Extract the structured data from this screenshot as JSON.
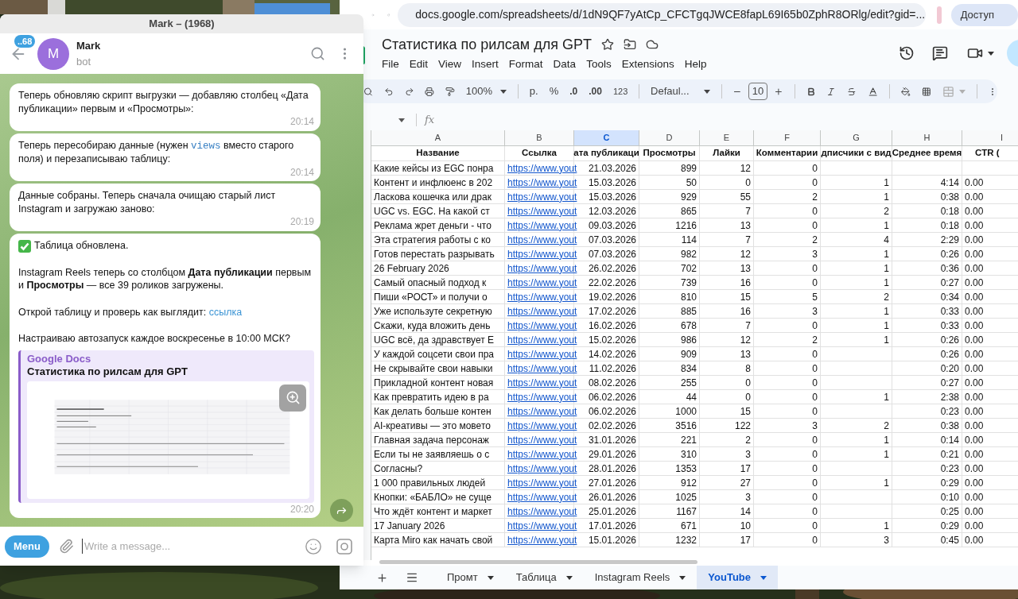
{
  "telegram": {
    "window_title": "Mark – (1968)",
    "unread_badge": "..68",
    "avatar_letter": "M",
    "chat_name": "Mark",
    "chat_status": "bot",
    "messages": [
      {
        "time": "20:14",
        "paragraphs": [
          {
            "parts": [
              {
                "kind": "text",
                "text": "Теперь обновляю скрипт выгрузки — добавляю столбец «Дата публикации» первым и «Просмотры»:"
              }
            ]
          }
        ]
      },
      {
        "time": "20:14",
        "paragraphs": [
          {
            "parts": [
              {
                "kind": "text",
                "text": "Теперь пересобираю данные (нужен "
              },
              {
                "kind": "code",
                "text": "views"
              },
              {
                "kind": "text",
                "text": " вместо старого поля) и перезаписываю таблицу:"
              }
            ]
          }
        ]
      },
      {
        "time": "20:19",
        "paragraphs": [
          {
            "parts": [
              {
                "kind": "text",
                "text": "Данные собраны. Теперь сначала очищаю старый лист Instagram и загружаю заново:"
              }
            ]
          }
        ]
      },
      {
        "time": "20:20",
        "paragraphs": [
          {
            "done": true,
            "parts": [
              {
                "kind": "text",
                "text": "Таблица обновлена."
              }
            ]
          },
          {
            "parts": [
              {
                "kind": "text",
                "text": "Instagram Reels теперь со столбцом **Дата публикации** первым и **Просмотры** — все 39 роликов загружены."
              }
            ]
          },
          {
            "parts": [
              {
                "kind": "text",
                "text": "Открой таблицу и проверь как выглядит: "
              },
              {
                "kind": "link",
                "text": "ссылка"
              }
            ]
          },
          {
            "parts": [
              {
                "kind": "text",
                "text": "Настраиваю автозапуск каждое воскресенье в 10:00 МСК?"
              }
            ]
          }
        ],
        "preview": {
          "site": "Google Docs",
          "title": "Статистика по рилсам для GPT"
        }
      }
    ],
    "menu_button": "Menu",
    "input": {
      "placeholder": "Write a message..."
    }
  },
  "browser": {
    "url": "docs.google.com/spreadsheets/d/1dN9QF7yAtCp_CFCTgqJWCE8fapL69I65b0ZphR8ORlg/edit?gid=...",
    "share_button": "Доступ"
  },
  "sheet": {
    "title": "Статистика по рилсам для GPT",
    "menu": [
      "File",
      "Edit",
      "View",
      "Insert",
      "Format",
      "Data",
      "Tools",
      "Extensions",
      "Help"
    ],
    "toolbar": {
      "zoom": "100%",
      "currency": "р.",
      "percent": "%",
      "decrease_decimal": ".0",
      "increase_decimal": ".00",
      "number_format": "123",
      "font": "Defaul...",
      "font_size": "10"
    },
    "formula_label": "fx",
    "columns": [
      {
        "letter": "A",
        "selected": false
      },
      {
        "letter": "B",
        "selected": false
      },
      {
        "letter": "C",
        "selected": true
      },
      {
        "letter": "D",
        "selected": false
      },
      {
        "letter": "E",
        "selected": false
      },
      {
        "letter": "F",
        "selected": false
      },
      {
        "letter": "G",
        "selected": false
      },
      {
        "letter": "H",
        "selected": false
      },
      {
        "letter": "I",
        "selected": false
      }
    ],
    "header_row": [
      "Название",
      "Ссылка",
      "ата публикаци",
      "Просмотры",
      "Лайки",
      "Комментарии",
      "дписчики с вид",
      "Среднее время",
      "CTR ("
    ],
    "rows": [
      {
        "title": "Какие кейсы из EGC понра",
        "link": "https://www.yout",
        "date": "21.03.2026",
        "views": "899",
        "likes": "12",
        "comments": "0"
      },
      {
        "title": "Контент и инфлюенс в 202",
        "link": "https://www.yout",
        "date": "15.03.2026",
        "views": "50",
        "likes": "0",
        "comments": "0",
        "subscribers": "1",
        "avg_time": "4:14",
        "ctr": "0.00"
      },
      {
        "title": "Ласкова кошечка или драк",
        "link": "https://www.yout",
        "date": "15.03.2026",
        "views": "929",
        "likes": "55",
        "comments": "2",
        "subscribers": "1",
        "avg_time": "0:38",
        "ctr": "0.00"
      },
      {
        "title": "UGC vs. EGC. На какой ст",
        "link": "https://www.yout",
        "date": "12.03.2026",
        "views": "865",
        "likes": "7",
        "comments": "0",
        "subscribers": "2",
        "avg_time": "0:18",
        "ctr": "0.00"
      },
      {
        "title": "Реклама жрет деньги - что",
        "link": "https://www.yout",
        "date": "09.03.2026",
        "views": "1216",
        "likes": "13",
        "comments": "0",
        "subscribers": "1",
        "avg_time": "0:18",
        "ctr": "0.00"
      },
      {
        "title": "Эта стратегия работы с ко",
        "link": "https://www.yout",
        "date": "07.03.2026",
        "views": "114",
        "likes": "7",
        "comments": "2",
        "subscribers": "4",
        "avg_time": "2:29",
        "ctr": "0.00"
      },
      {
        "title": "Готов перестать разрывать",
        "link": "https://www.yout",
        "date": "07.03.2026",
        "views": "982",
        "likes": "12",
        "comments": "3",
        "subscribers": "1",
        "avg_time": "0:26",
        "ctr": "0.00"
      },
      {
        "title": "26 February 2026",
        "link": "https://www.yout",
        "date": "26.02.2026",
        "views": "702",
        "likes": "13",
        "comments": "0",
        "subscribers": "1",
        "avg_time": "0:36",
        "ctr": "0.00"
      },
      {
        "title": "Самый опасный подход к",
        "link": "https://www.yout",
        "date": "22.02.2026",
        "views": "739",
        "likes": "16",
        "comments": "0",
        "subscribers": "1",
        "avg_time": "0:27",
        "ctr": "0.00"
      },
      {
        "title": "Пиши «РОСТ»  и получи о",
        "link": "https://www.yout",
        "date": "19.02.2026",
        "views": "810",
        "likes": "15",
        "comments": "5",
        "subscribers": "2",
        "avg_time": "0:34",
        "ctr": "0.00"
      },
      {
        "title": "Уже используте секретную",
        "link": "https://www.yout",
        "date": "17.02.2026",
        "views": "885",
        "likes": "16",
        "comments": "3",
        "subscribers": "1",
        "avg_time": "0:33",
        "ctr": "0.00"
      },
      {
        "title": "Скажи, куда вложить день",
        "link": "https://www.yout",
        "date": "16.02.2026",
        "views": "678",
        "likes": "7",
        "comments": "0",
        "subscribers": "1",
        "avg_time": "0:33",
        "ctr": "0.00"
      },
      {
        "title": "UGC всё, да здравствует E",
        "link": "https://www.yout",
        "date": "15.02.2026",
        "views": "986",
        "likes": "12",
        "comments": "2",
        "subscribers": "1",
        "avg_time": "0:26",
        "ctr": "0.00"
      },
      {
        "title": "У каждой соцсети свои пра",
        "link": "https://www.yout",
        "date": "14.02.2026",
        "views": "909",
        "likes": "13",
        "comments": "0",
        "avg_time": "0:26",
        "ctr": "0.00"
      },
      {
        "title": "Не скрывайте свои навыки",
        "link": "https://www.yout",
        "date": "11.02.2026",
        "views": "834",
        "likes": "8",
        "comments": "0",
        "avg_time": "0:20",
        "ctr": "0.00"
      },
      {
        "title": "Прикладной контент новая",
        "link": "https://www.yout",
        "date": "08.02.2026",
        "views": "255",
        "likes": "0",
        "comments": "0",
        "avg_time": "0:27",
        "ctr": "0.00"
      },
      {
        "title": "Как превратить идею в ра",
        "link": "https://www.yout",
        "date": "06.02.2026",
        "views": "44",
        "likes": "0",
        "comments": "0",
        "subscribers": "1",
        "avg_time": "2:38",
        "ctr": "0.00"
      },
      {
        "title": "Как делать больше контен",
        "link": "https://www.yout",
        "date": "06.02.2026",
        "views": "1000",
        "likes": "15",
        "comments": "0",
        "avg_time": "0:23",
        "ctr": "0.00"
      },
      {
        "title": "AI-креативы — это мовето",
        "link": "https://www.yout",
        "date": "02.02.2026",
        "views": "3516",
        "likes": "122",
        "comments": "3",
        "subscribers": "2",
        "avg_time": "0:38",
        "ctr": "0.00"
      },
      {
        "title": "Главная задача персонаж",
        "link": "https://www.yout",
        "date": "31.01.2026",
        "views": "221",
        "likes": "2",
        "comments": "0",
        "subscribers": "1",
        "avg_time": "0:14",
        "ctr": "0.00"
      },
      {
        "title": "Если ты не заявляешь о с",
        "link": "https://www.yout",
        "date": "29.01.2026",
        "views": "310",
        "likes": "3",
        "comments": "0",
        "subscribers": "1",
        "avg_time": "0:21",
        "ctr": "0.00"
      },
      {
        "title": "Согласны?",
        "link": "https://www.yout",
        "date": "28.01.2026",
        "views": "1353",
        "likes": "17",
        "comments": "0",
        "avg_time": "0:23",
        "ctr": "0.00"
      },
      {
        "title": "1 000 правильных людей",
        "link": "https://www.yout",
        "date": "27.01.2026",
        "views": "912",
        "likes": "27",
        "comments": "0",
        "subscribers": "1",
        "avg_time": "0:29",
        "ctr": "0.00"
      },
      {
        "title": "Кнопки: «БАБЛО» не суще",
        "link": "https://www.yout",
        "date": "26.01.2026",
        "views": "1025",
        "likes": "3",
        "comments": "0",
        "avg_time": "0:10",
        "ctr": "0.00"
      },
      {
        "title": "Что ждёт контент и маркет",
        "link": "https://www.yout",
        "date": "25.01.2026",
        "views": "1167",
        "likes": "14",
        "comments": "0",
        "avg_time": "0:25",
        "ctr": "0.00"
      },
      {
        "title": "17 January 2026",
        "link": "https://www.yout",
        "date": "17.01.2026",
        "views": "671",
        "likes": "10",
        "comments": "0",
        "subscribers": "1",
        "avg_time": "0:29",
        "ctr": "0.00"
      },
      {
        "title": "Карта Miro как начать свой",
        "link": "https://www.yout",
        "date": "15.01.2026",
        "views": "1232",
        "likes": "17",
        "comments": "0",
        "subscribers": "3",
        "avg_time": "0:45",
        "ctr": "0.00"
      }
    ],
    "tabs": [
      {
        "label": "Промт",
        "selected": false
      },
      {
        "label": "Таблица",
        "selected": false
      },
      {
        "label": "Instagram Reels",
        "selected": false
      },
      {
        "label": "YouTube",
        "selected": true
      }
    ]
  }
}
